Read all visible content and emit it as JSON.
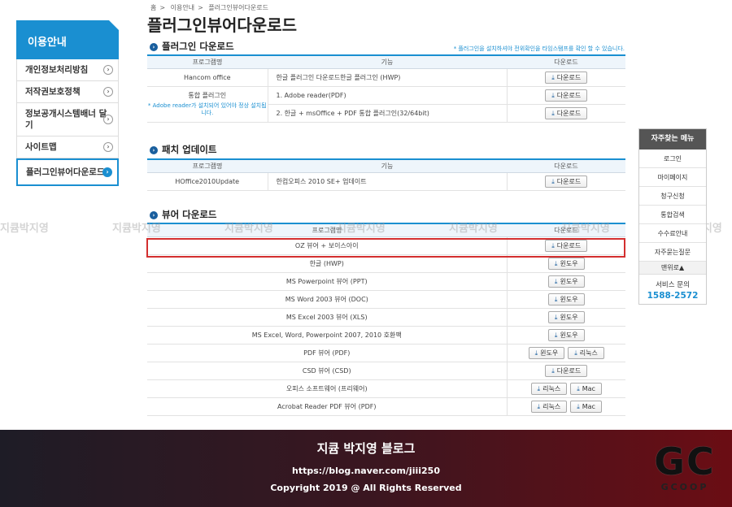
{
  "breadcrumb": [
    "홈",
    "이용안내",
    "플러그인뷰어다운로드"
  ],
  "page_title": "플러그인뷰어다운로드",
  "sidebar": {
    "heading": "이용안내",
    "items": [
      {
        "label": "개인정보처리방침"
      },
      {
        "label": "저작권보호정책"
      },
      {
        "label": "정보공개시스템배너 달기"
      },
      {
        "label": "사이트맵"
      },
      {
        "label": "플러그인뷰어다운로드"
      }
    ]
  },
  "sections": {
    "plugin": {
      "title": "플러그인 다운로드",
      "note": "* 플러그인을 설치하셔야 전위확인을 타임스탬프를 확인 할 수 있습니다.",
      "headers": [
        "프로그램명",
        "기능",
        "다운로드"
      ],
      "rows": [
        {
          "name": "Hancom office",
          "func": "한글 플러그인 다운로드한글 플러그인 (HWP)",
          "btn": "다운로드"
        },
        {
          "name": "통합 플러그인",
          "note": "* Adobe reader가 설치되어 있어야 정상 설치됩니다.",
          "func": "1. Adobe reader(PDF)",
          "btn": "다운로드"
        },
        {
          "func": "2. 한글 + msOffice + PDF 통합 플러그인(32/64bit)",
          "btn": "다운로드"
        }
      ]
    },
    "patch": {
      "title": "패치 업데이트",
      "headers": [
        "프로그램명",
        "기능",
        "다운로드"
      ],
      "rows": [
        {
          "name": "HOffice2010Update",
          "func": "한컴오피스 2010 SE+ 업데이트",
          "btn": "다운로드"
        }
      ]
    },
    "viewer": {
      "title": "뷰어 다운로드",
      "headers": [
        "프로그램명",
        "다운로드"
      ],
      "rows": [
        {
          "name": "OZ 뷰어 + 보이스아이",
          "btns": [
            "다운로드"
          ]
        },
        {
          "name": "한글 (HWP)",
          "btns": [
            "윈도우"
          ]
        },
        {
          "name": "MS Powerpoint 뷰어 (PPT)",
          "btns": [
            "윈도우"
          ]
        },
        {
          "name": "MS Word 2003 뷰어 (DOC)",
          "btns": [
            "윈도우"
          ]
        },
        {
          "name": "MS Excel 2003 뷰어 (XLS)",
          "btns": [
            "윈도우"
          ]
        },
        {
          "name": "MS Excel, Word, Powerpoint 2007, 2010 호환팩",
          "btns": [
            "윈도우"
          ]
        },
        {
          "name": "PDF 뷰어 (PDF)",
          "btns": [
            "윈도우",
            "리눅스"
          ]
        },
        {
          "name": "CSD 뷰어 (CSD)",
          "btns": [
            "다운로드"
          ]
        },
        {
          "name": "오피스 소프트웨어 (프리웨어)",
          "btns": [
            "리눅스",
            "Mac"
          ]
        },
        {
          "name": "Acrobat Reader PDF 뷰어 (PDF)",
          "btns": [
            "리눅스",
            "Mac"
          ]
        }
      ]
    }
  },
  "watermark": "지큠박지영",
  "quick_menu": {
    "heading": "자주찾는 메뉴",
    "items": [
      "로그인",
      "마이페이지",
      "청구신청",
      "통합검색",
      "수수료안내",
      "자주묻는질문"
    ],
    "top": "맨위로▲",
    "service_label": "서비스 문의",
    "service_number": "1588-2572"
  },
  "footer": {
    "blog_name": "지큠 박지영 블로그",
    "url": "https://blog.naver.com/jiii250",
    "copyright": "Copyright 2019 @ All Rights Reserved",
    "logo_letters": "GC",
    "logo_sub": "GCOOP"
  },
  "colors": {
    "accent": "#1a8fd1",
    "highlight": "#d32f2f",
    "quick_head": "#555555"
  }
}
